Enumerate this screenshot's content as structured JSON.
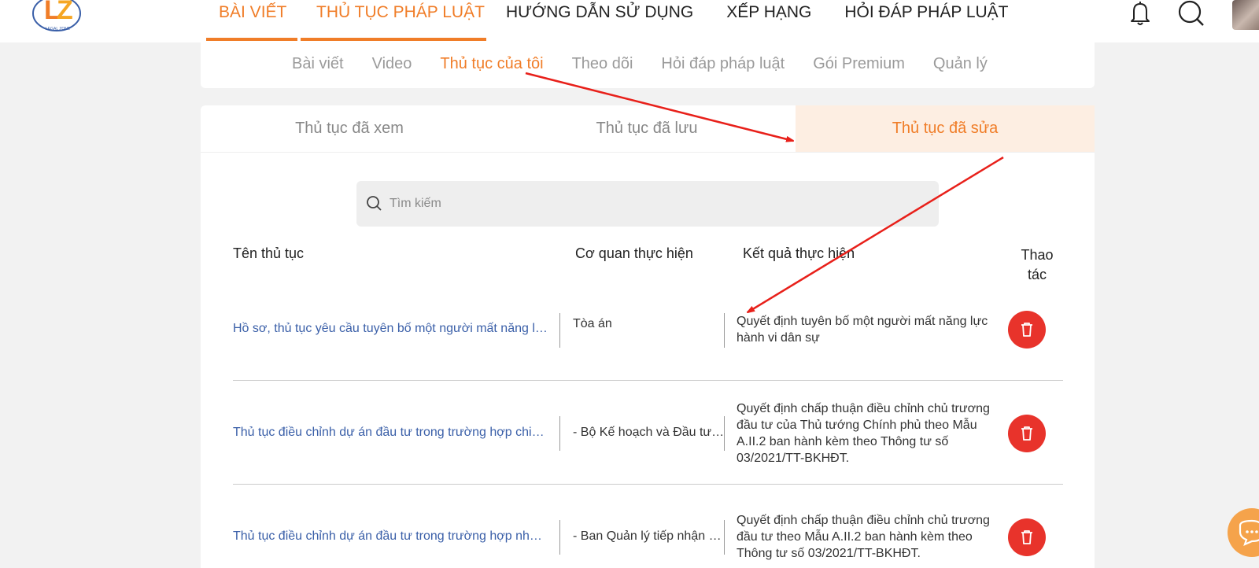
{
  "header": {
    "logo_text": "LEGAL ZONE",
    "nav": [
      {
        "label": "BÀI VIẾT",
        "active": true
      },
      {
        "label": "THỦ TỤC PHÁP LUẬT",
        "active": true
      },
      {
        "label": "HƯỚNG DẪN SỬ DỤNG",
        "active": false
      },
      {
        "label": "XẾP HẠNG",
        "active": false
      },
      {
        "label": "HỎI ĐÁP PHÁP LUẬT",
        "active": false
      }
    ],
    "icons": [
      "bell-icon",
      "search-icon",
      "avatar"
    ]
  },
  "subnav": {
    "items": [
      {
        "label": "Bài viết"
      },
      {
        "label": "Video"
      },
      {
        "label": "Thủ tục của tôi",
        "active": true
      },
      {
        "label": "Theo dõi"
      },
      {
        "label": "Hỏi đáp pháp luật"
      },
      {
        "label": "Gói Premium"
      },
      {
        "label": "Quản lý"
      }
    ]
  },
  "tabs": [
    {
      "label": "Thủ tục đã xem"
    },
    {
      "label": "Thủ tục đã lưu"
    },
    {
      "label": "Thủ tục đã sửa",
      "active": true
    }
  ],
  "search": {
    "placeholder": "Tìm kiếm",
    "value": ""
  },
  "table": {
    "headers": {
      "name": "Tên thủ tục",
      "agency": "Cơ quan thực hiện",
      "result": "Kết quả thực hiện",
      "action": "Thao tác"
    },
    "rows": [
      {
        "name": "Hồ sơ, thủ tục yêu cầu tuyên bố một người mất năng lực hành vi dân sự",
        "agency": "Tòa án",
        "result": "Quyết định tuyên bố một người mất năng lực hành vi dân sự"
      },
      {
        "name": "Thủ tục điều chỉnh dự án đầu tư trong trường hợp chia, tách, hợp nhất",
        "agency": "- Bộ Kế hoạch và Đầu tư; - Thủ tướng Chính phủ",
        "result": "Quyết định chấp thuận điều chỉnh chủ trương đầu tư của Thủ tướng Chính phủ theo Mẫu A.II.2 ban hành kèm theo Thông tư số 03/2021/TT-BKHĐT."
      },
      {
        "name": "Thủ tục điều chỉnh dự án đầu tư trong trường hợp nhà đầu tư",
        "agency": "- Ban Quản lý tiếp nhận hồ sơ",
        "result": "Quyết định chấp thuận điều chỉnh chủ trương đầu tư theo Mẫu A.II.2 ban hành kèm theo Thông tư số 03/2021/TT-BKHĐT."
      }
    ]
  },
  "colors": {
    "accent": "#f07d28",
    "link": "#3a5fa8",
    "delete": "#e8332b",
    "arrow": "#e8201a"
  }
}
